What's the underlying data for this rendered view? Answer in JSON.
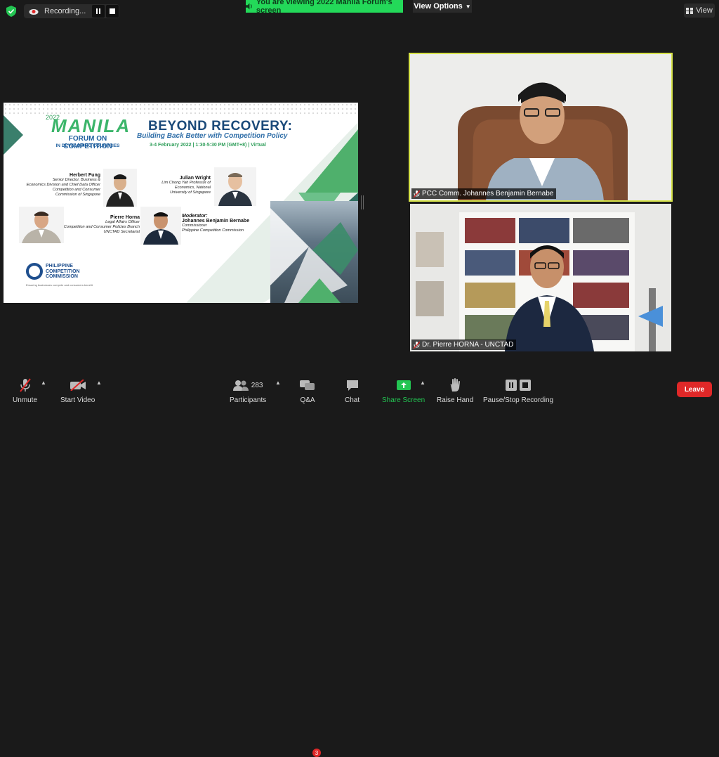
{
  "recording": {
    "label": "Recording..."
  },
  "banner": {
    "text": "You are viewing 2022 Manila Forum's screen"
  },
  "view_options": {
    "label": "View Options"
  },
  "view": {
    "label": "View"
  },
  "slide": {
    "logo_year": "2022",
    "logo_manila": "MANILA",
    "logo_forum": "FORUM ON COMPETITION",
    "logo_sub": "IN DEVELOPING COUNTRIES",
    "title": "BEYOND RECOVERY:",
    "subtitle": "Building Back Better with Competition Policy",
    "date": "3-4 February 2022 | 1:30-5:30 PM (GMT+8) | Virtual",
    "speakers": [
      {
        "name": "Herbert Fung",
        "lines": [
          "Senior Director, Business &",
          "Economics Division and Chief Data Officer",
          "Competition and Consumer",
          "Commission of Singapore"
        ]
      },
      {
        "name": "Julian Wright",
        "lines": [
          "Lim Chong Yah Professor of",
          "Economics, National",
          "University of Singapore"
        ]
      },
      {
        "name": "Pierre Horna",
        "lines": [
          "Legal Affairs Officer",
          "Competition and Consumer Policies Branch",
          "UNCTAD Secretariat"
        ]
      },
      {
        "name": "Johannes Benjamin Bernabe",
        "prefix": "Moderator:",
        "lines": [
          "Commissioner",
          "Philippine Competition Commission"
        ]
      }
    ],
    "pcc": [
      "PHILIPPINE",
      "COMPETITION",
      "COMMISSION"
    ],
    "pcc_tagline": "Ensuring businesses compete and consumers benefit"
  },
  "participants_video": [
    {
      "name": "PCC Comm. Johannes Benjamin Bernabe"
    },
    {
      "name": "Dr. Pierre HORNA - UNCTAD"
    }
  ],
  "toolbar": {
    "unmute": "Unmute",
    "start_video": "Start Video",
    "participants": "Participants",
    "participants_count": "283",
    "qa": "Q&A",
    "qa_badge": "3",
    "chat": "Chat",
    "share_screen": "Share Screen",
    "raise_hand": "Raise Hand",
    "pause_stop": "Pause/Stop Recording",
    "leave": "Leave"
  },
  "colors": {
    "banner_green": "#23d959",
    "leave_red": "#e02828",
    "active_speaker": "#d7e34a",
    "share_green": "#23c552"
  }
}
